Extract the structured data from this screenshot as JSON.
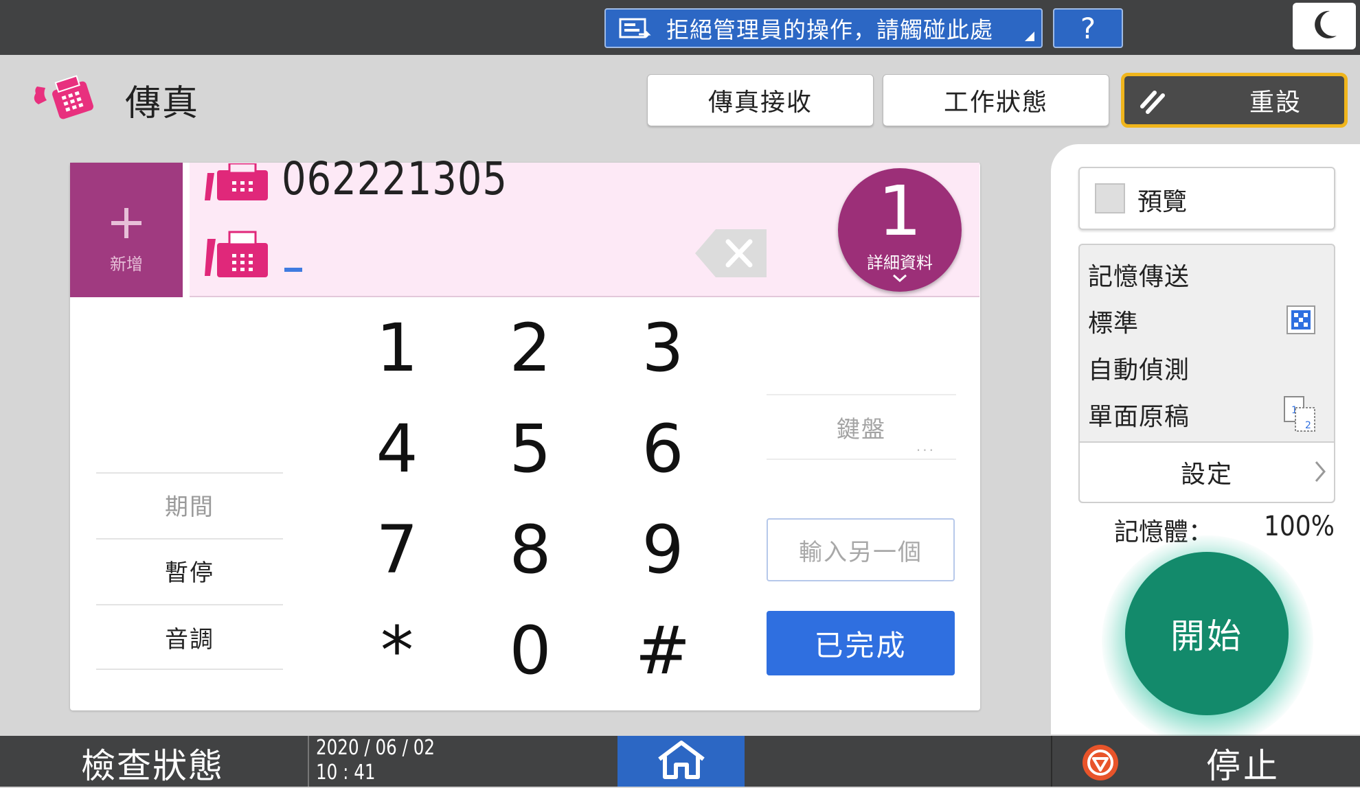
{
  "topbar": {
    "admin_message": "拒絕管理員的操作，請觸碰此處",
    "help_label": "?"
  },
  "header": {
    "app_title": "傳真",
    "fax_receive_label": "傳真接收",
    "job_status_label": "工作狀態",
    "reset_label": "重設"
  },
  "destination": {
    "add_label": "新增",
    "fax_number": "062221305",
    "count": "1",
    "details_label": "詳細資料"
  },
  "keypad": {
    "keys": [
      "1",
      "2",
      "3",
      "4",
      "5",
      "6",
      "7",
      "8",
      "9",
      "*",
      "0",
      "#"
    ],
    "period_label": "期間",
    "pause_label": "暫停",
    "tone_label": "音調",
    "keyboard_label": "鍵盤",
    "keyboard_dots": "...",
    "input_another_label": "輸入另一個",
    "done_label": "已完成"
  },
  "settings": {
    "preview_label": "預覽",
    "memory_transmission": "記憶傳送",
    "resolution": "標準",
    "auto_detect": "自動偵測",
    "single_sided": "單面原稿",
    "settings_label": "設定",
    "memory_label": "記憶體：",
    "memory_value": "100%",
    "start_label": "開始"
  },
  "bottombar": {
    "check_status_label": "檢查狀態",
    "date": "2020 / 06 / 02",
    "time": "10 : 41",
    "stop_label": "停止"
  },
  "colors": {
    "accent_blue": "#2c67c4",
    "fax_magenta": "#a03a80",
    "start_green": "#138a6b",
    "reset_border": "#f0b51c"
  }
}
